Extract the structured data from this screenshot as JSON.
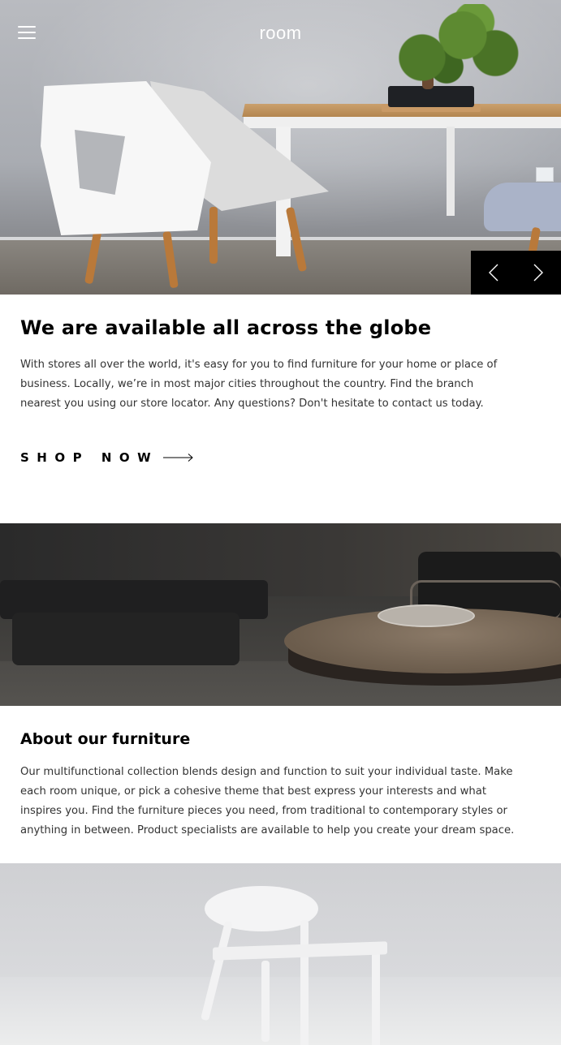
{
  "header": {
    "menu_icon": "hamburger-menu-icon",
    "logo": "room"
  },
  "hero": {
    "slider": {
      "prev_icon": "chevron-left-icon",
      "next_icon": "chevron-right-icon"
    },
    "title": "We are available all across the globe",
    "description": "With stores all over the world, it's easy for you to find furniture for your home or place of business. Locally, we’re in most major cities throughout the country. Find the branch nearest you using our store locator. Any questions? Don't hesitate to contact us today.",
    "cta_label": "SHOP NOW",
    "cta_icon": "arrow-right-icon"
  },
  "about": {
    "title": "About our furniture",
    "description": "Our multifunctional collection blends design and function to suit your individual taste. Make each room unique, or pick a cohesive theme that best express your interests and what inspires you. Find the furniture pieces you need, from traditional to contemporary styles or anything in between. Product specialists are available to help you create your dream space."
  },
  "colors": {
    "primary_text": "#000000",
    "body_text": "#333333",
    "slider_bg": "#000000",
    "background": "#ffffff"
  }
}
